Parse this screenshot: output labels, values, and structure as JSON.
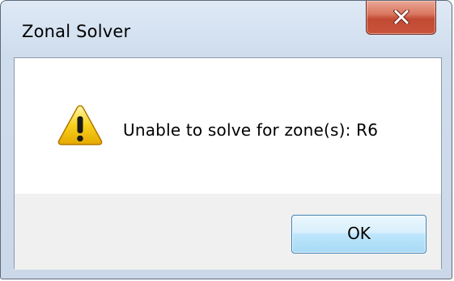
{
  "window": {
    "title": "Zonal Solver",
    "close_icon": "close-icon"
  },
  "dialog": {
    "icon": "warning-icon",
    "message": "Unable to solve for zone(s): R6",
    "ok_label": "OK"
  },
  "colors": {
    "close_button": "#c8533a",
    "ok_button_border": "#3c7fb1",
    "warning_yellow": "#f7d21c"
  }
}
